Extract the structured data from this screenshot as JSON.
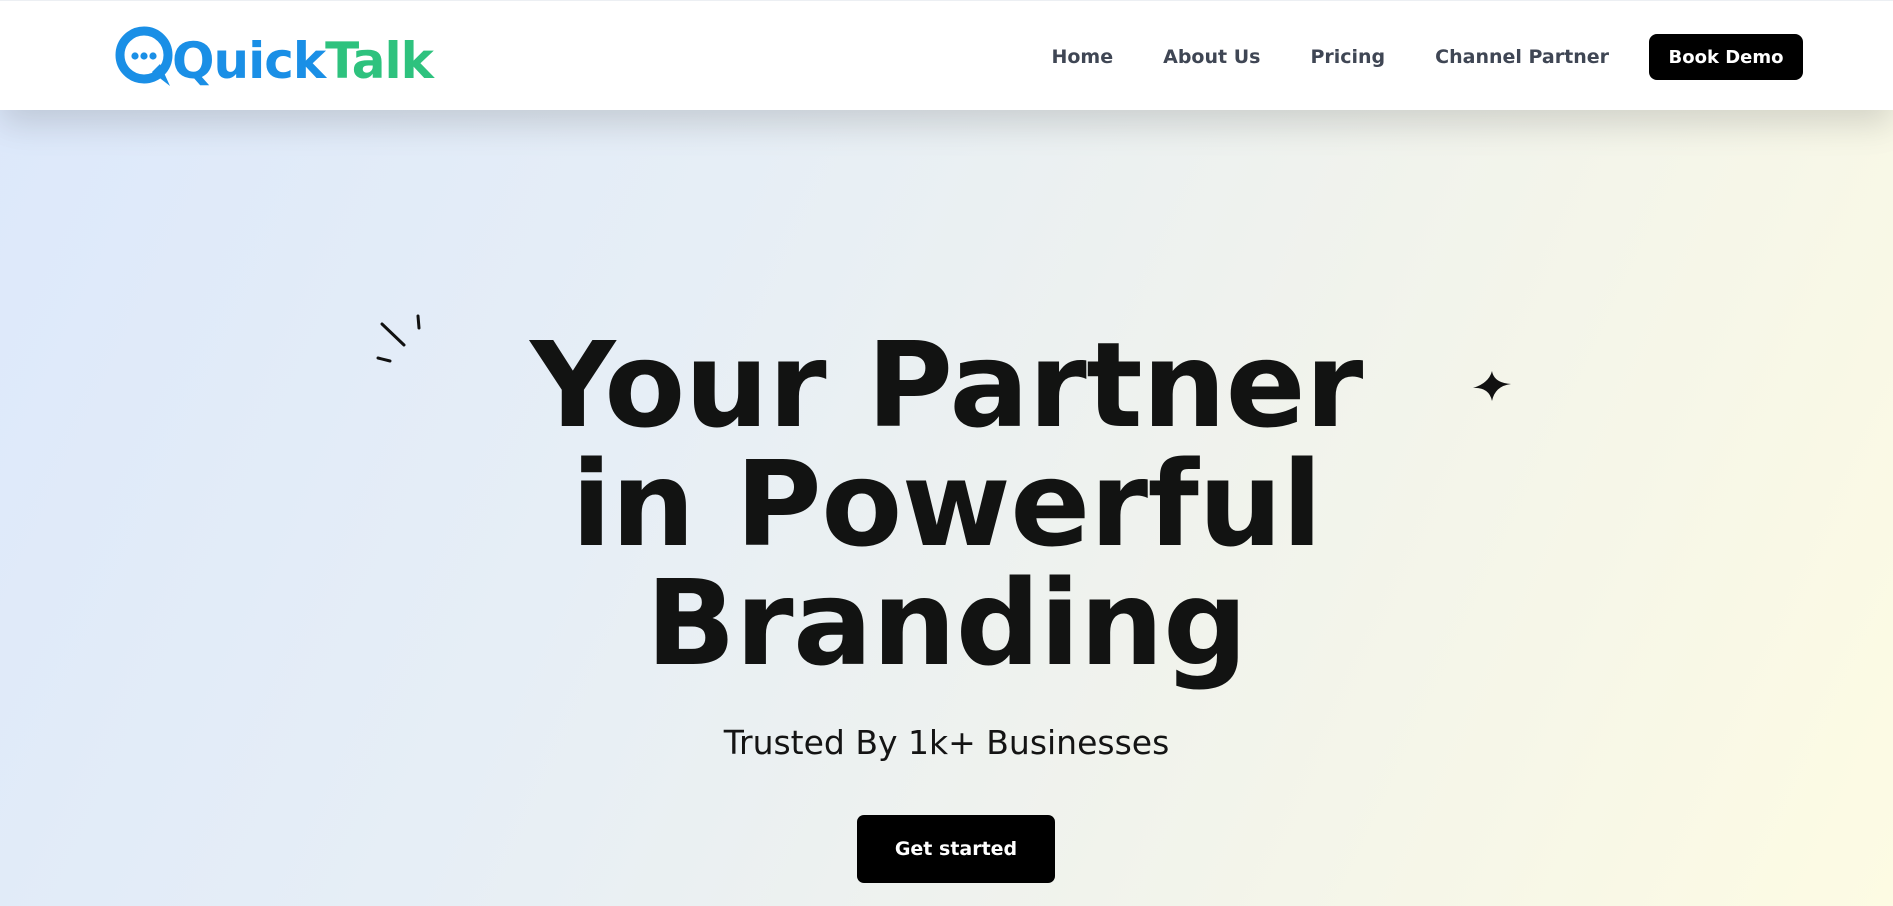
{
  "brand": {
    "name_part1": "Quick",
    "name_part2": "Talk",
    "color_primary": "#1a8fe6",
    "color_secondary": "#2ec27e"
  },
  "nav": {
    "items": [
      {
        "label": "Home"
      },
      {
        "label": "About Us"
      },
      {
        "label": "Pricing"
      },
      {
        "label": "Channel Partner"
      }
    ],
    "cta_label": "Book Demo"
  },
  "hero": {
    "headline_lines": [
      "Your Partner",
      "in Powerful",
      "Branding"
    ],
    "subtitle": "Trusted By 1k+ Businesses",
    "cta_label": "Get started",
    "decorations": [
      "sparkle-lines-icon",
      "four-point-star-icon"
    ]
  }
}
